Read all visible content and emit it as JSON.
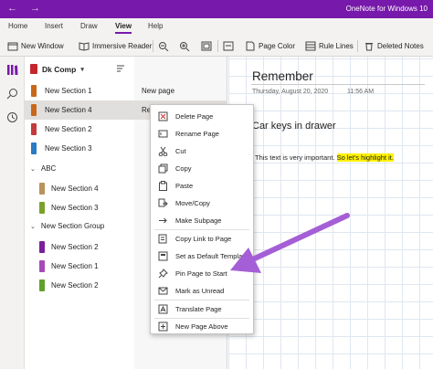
{
  "window": {
    "title": "OneNote for Windows 10",
    "back_arrow": "←",
    "forward_arrow": "→"
  },
  "ribbon": {
    "tabs": [
      {
        "label": "Home",
        "active": false
      },
      {
        "label": "Insert",
        "active": false
      },
      {
        "label": "Draw",
        "active": false
      },
      {
        "label": "View",
        "active": true
      },
      {
        "label": "Help",
        "active": false
      }
    ]
  },
  "toolbar": {
    "new_window": "New Window",
    "immersive_reader": "Immersive Reader",
    "page_color": "Page Color",
    "rule_lines": "Rule Lines",
    "deleted_notes": "Deleted Notes"
  },
  "notebook": {
    "name": "Dk Comp",
    "sections": [
      {
        "label": "New Section 1",
        "color": "#c8681b",
        "indent": false
      },
      {
        "label": "New Section 4",
        "color": "#c8681b",
        "indent": false,
        "selected": true
      },
      {
        "label": "New Section 2",
        "color": "#c33b3b",
        "indent": false
      },
      {
        "label": "New Section 3",
        "color": "#2b7bc2",
        "indent": false
      }
    ],
    "groups": [
      {
        "label": "ABC",
        "sections": [
          {
            "label": "New Section 4",
            "color": "#b9935a"
          },
          {
            "label": "New Section 3",
            "color": "#7aa12c"
          }
        ]
      },
      {
        "label": "New Section Group",
        "sections": [
          {
            "label": "New Section 2",
            "color": "#7a1f9c"
          },
          {
            "label": "New Section 1",
            "color": "#a64ab8"
          },
          {
            "label": "New Section 2",
            "color": "#5fa12c"
          }
        ]
      }
    ]
  },
  "pages": [
    {
      "label": "New page",
      "selected": false
    },
    {
      "label": "Re",
      "selected": true
    }
  ],
  "note": {
    "title": "Remember",
    "date": "Thursday, August 20, 2020",
    "time": "11:56 AM",
    "heading": "Car keys in drawer",
    "body_plain": "This text is very important.",
    "body_highlight": "So let's highlight it."
  },
  "context_menu": {
    "items": [
      {
        "label": "Delete Page",
        "icon": "delete-icon"
      },
      {
        "label": "Rename Page",
        "icon": "rename-icon"
      },
      {
        "label": "Cut",
        "icon": "cut-icon"
      },
      {
        "label": "Copy",
        "icon": "copy-icon"
      },
      {
        "label": "Paste",
        "icon": "paste-icon"
      },
      {
        "label": "Move/Copy",
        "icon": "move-copy-icon"
      },
      {
        "label": "Make Subpage",
        "icon": "subpage-icon"
      },
      {
        "label": "Copy Link to Page",
        "icon": "link-icon"
      },
      {
        "label": "Set as Default Template",
        "icon": "template-icon"
      },
      {
        "label": "Pin Page to Start",
        "icon": "pin-icon"
      },
      {
        "label": "Mark as Unread",
        "icon": "mark-unread-icon"
      },
      {
        "label": "Translate Page",
        "icon": "translate-icon"
      },
      {
        "label": "New Page Above",
        "icon": "new-page-icon"
      }
    ]
  },
  "colors": {
    "accent": "#7719aa",
    "highlight": "#fff100",
    "arrow": "#a55fd6"
  }
}
